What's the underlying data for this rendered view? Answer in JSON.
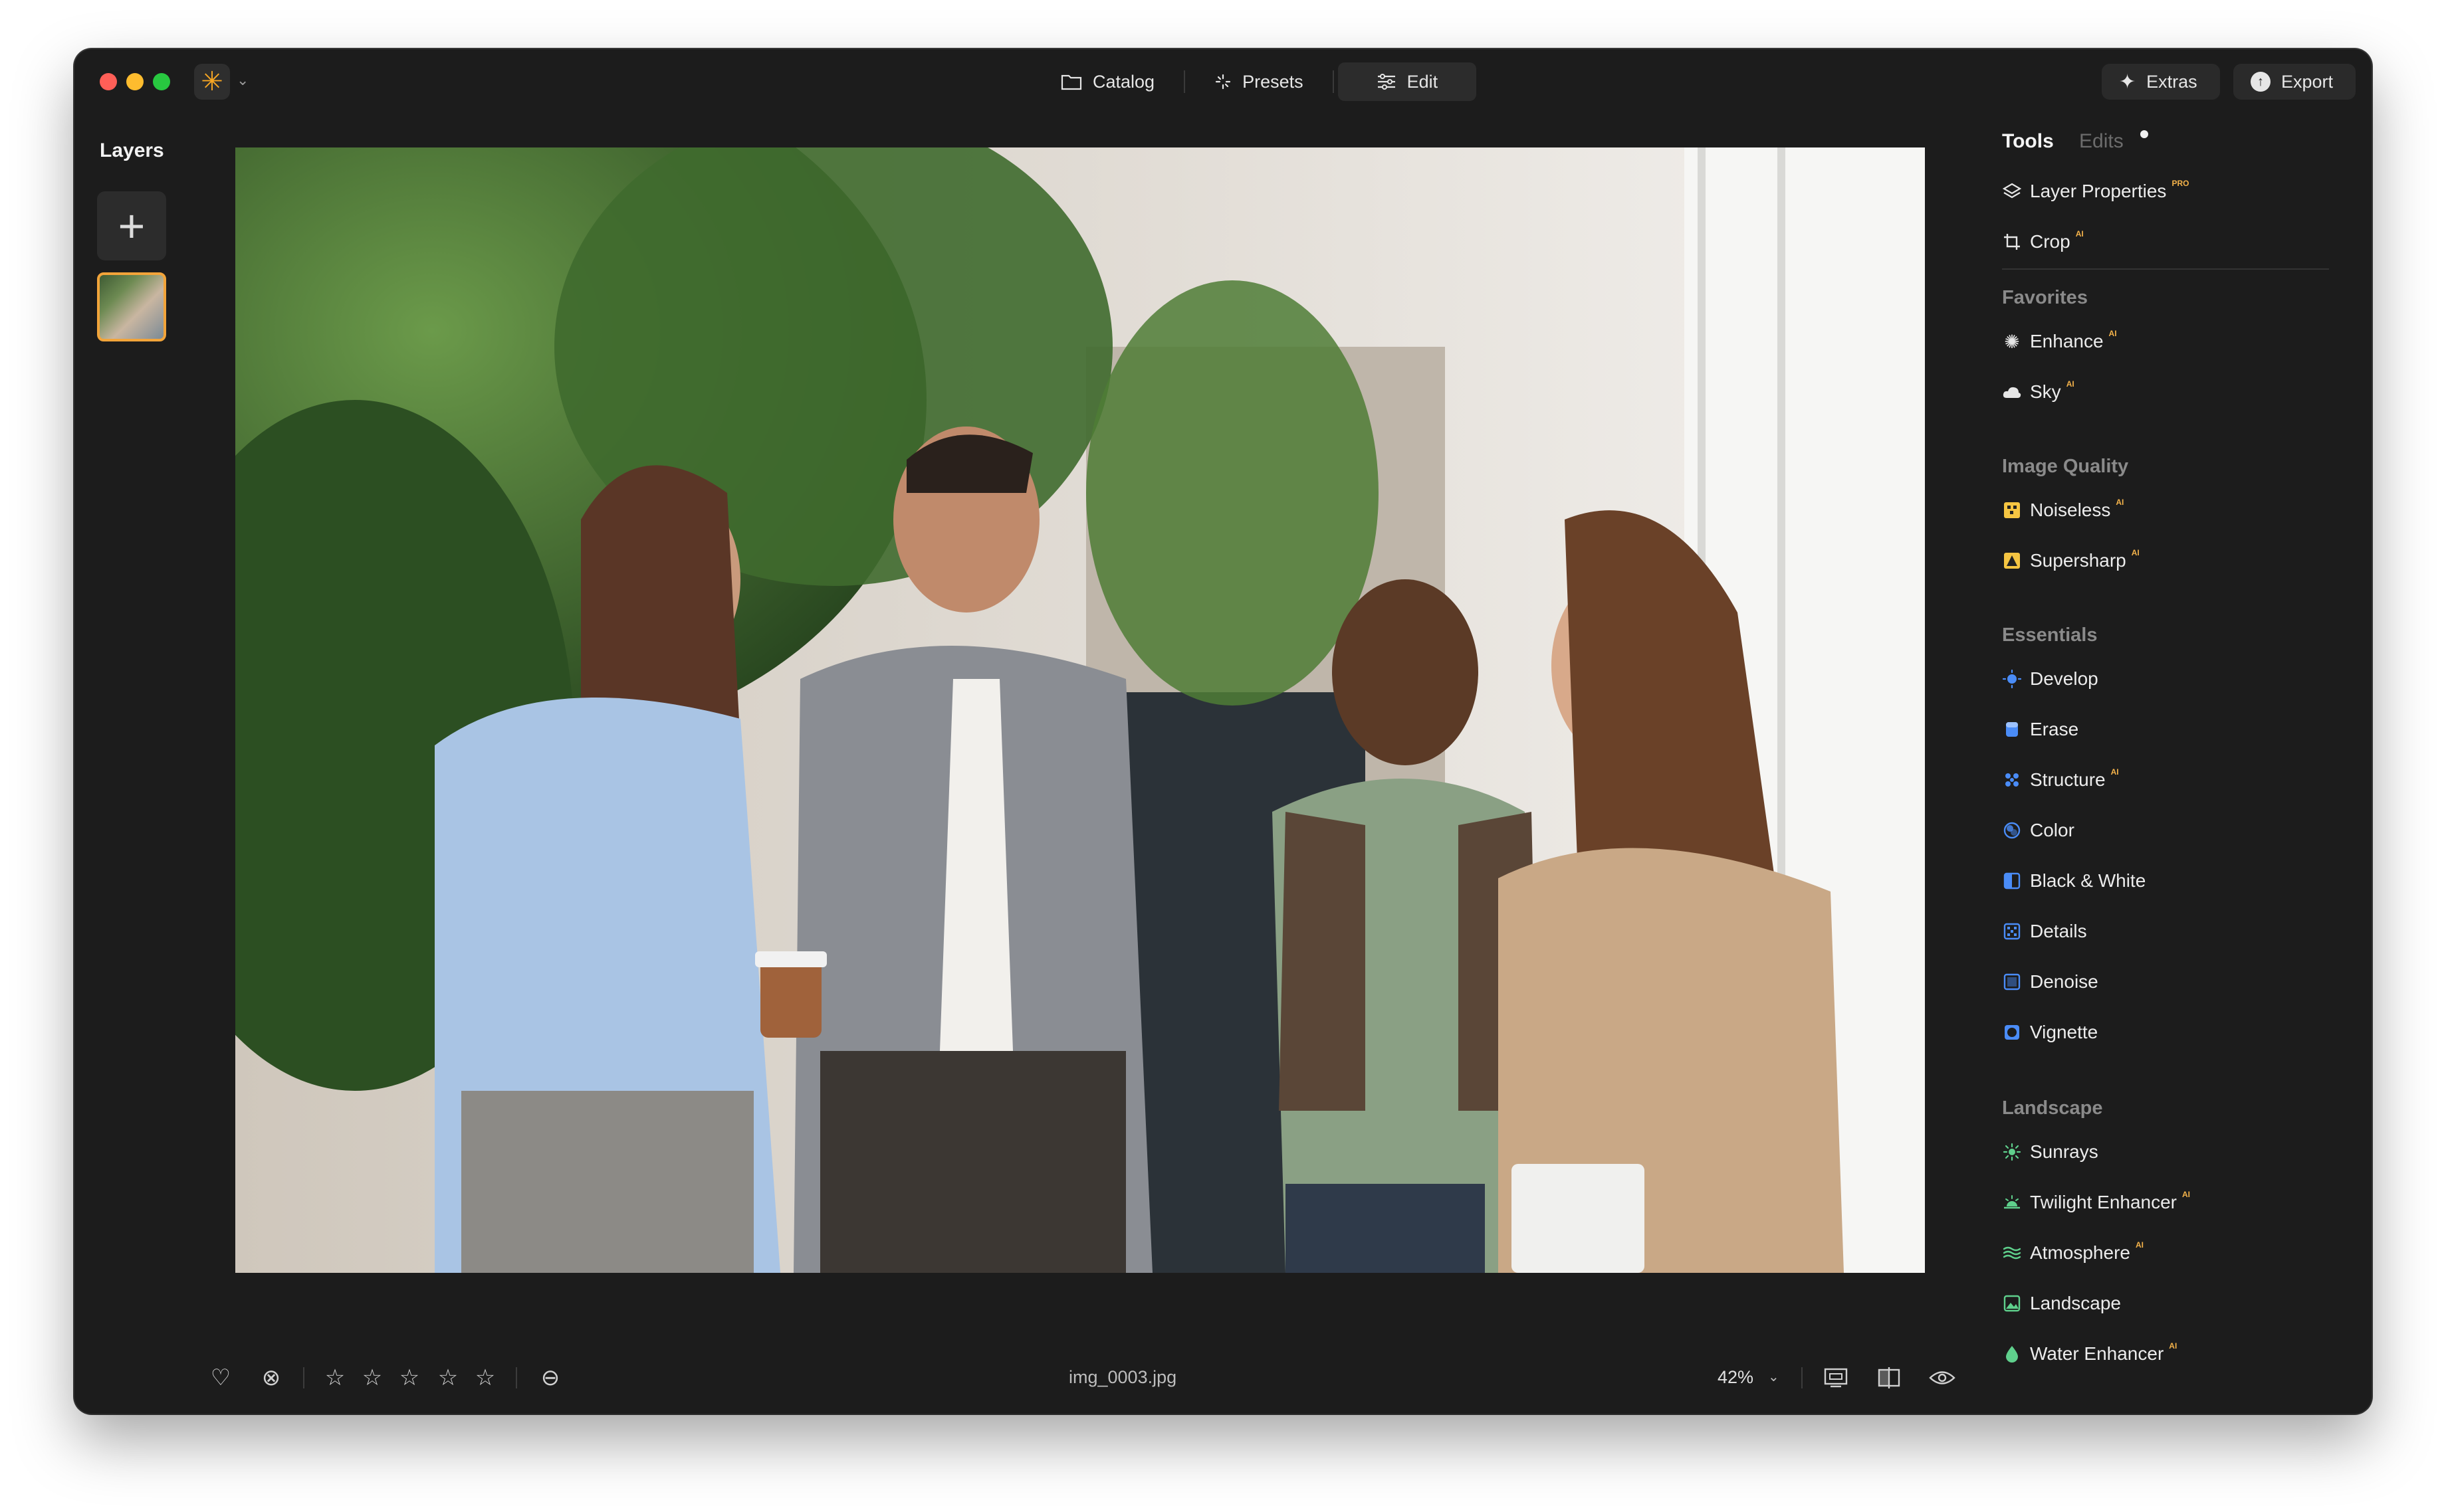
{
  "titlebar": {
    "nav_tabs": [
      {
        "label": "Catalog",
        "icon": "folder-icon"
      },
      {
        "label": "Presets",
        "icon": "sparkle-icon"
      },
      {
        "label": "Edit",
        "icon": "sliders-icon",
        "active": true
      }
    ],
    "extras_label": "Extras",
    "export_label": "Export"
  },
  "layers": {
    "title": "Layers",
    "thumbnail_selected": true
  },
  "canvas": {
    "image": "photo of four colleagues talking and laughing by a window with plants"
  },
  "bottom_bar": {
    "filename": "img_0003.jpg",
    "zoom": "42%",
    "rating_stars": 5,
    "rating_value": 0
  },
  "right_panel": {
    "tabs": {
      "tools": "Tools",
      "edits": "Edits"
    },
    "top_items": [
      {
        "label": "Layer Properties",
        "badge": "PRO",
        "icon": "layers-icon"
      },
      {
        "label": "Crop",
        "badge": "AI",
        "icon": "crop-icon"
      }
    ],
    "favorites": {
      "title": "Favorites",
      "items": [
        {
          "label": "Enhance",
          "badge": "AI",
          "icon": "enhance-icon"
        },
        {
          "label": "Sky",
          "badge": "AI",
          "icon": "cloud-icon"
        }
      ]
    },
    "image_quality": {
      "title": "Image Quality",
      "items": [
        {
          "label": "Noiseless",
          "badge": "AI",
          "icon": "noiseless-icon"
        },
        {
          "label": "Supersharp",
          "badge": "AI",
          "icon": "supersharp-icon"
        }
      ]
    },
    "essentials": {
      "title": "Essentials",
      "items": [
        {
          "label": "Develop",
          "badge": "",
          "icon": "develop-icon"
        },
        {
          "label": "Erase",
          "badge": "",
          "icon": "erase-icon"
        },
        {
          "label": "Structure",
          "badge": "AI",
          "icon": "structure-icon"
        },
        {
          "label": "Color",
          "badge": "",
          "icon": "color-icon"
        },
        {
          "label": "Black & White",
          "badge": "",
          "icon": "black-white-icon"
        },
        {
          "label": "Details",
          "badge": "",
          "icon": "details-icon"
        },
        {
          "label": "Denoise",
          "badge": "",
          "icon": "denoise-icon"
        },
        {
          "label": "Vignette",
          "badge": "",
          "icon": "vignette-icon"
        }
      ]
    },
    "landscape": {
      "title": "Landscape",
      "items": [
        {
          "label": "Sunrays",
          "badge": "",
          "icon": "sunrays-icon"
        },
        {
          "label": "Twilight Enhancer",
          "badge": "AI",
          "icon": "twilight-icon"
        },
        {
          "label": "Atmosphere",
          "badge": "AI",
          "icon": "atmosphere-icon"
        },
        {
          "label": "Landscape",
          "badge": "",
          "icon": "landscape-icon"
        },
        {
          "label": "Water Enhancer",
          "badge": "AI",
          "icon": "water-drop-icon"
        }
      ]
    }
  },
  "colors": {
    "window_bg": "#1c1c1c",
    "accent_orange": "#f2a43a",
    "badge": "#f3b24a",
    "icon_blue": "#4a8cf7",
    "icon_green": "#5fd08c",
    "icon_yellow": "#f5c542"
  }
}
